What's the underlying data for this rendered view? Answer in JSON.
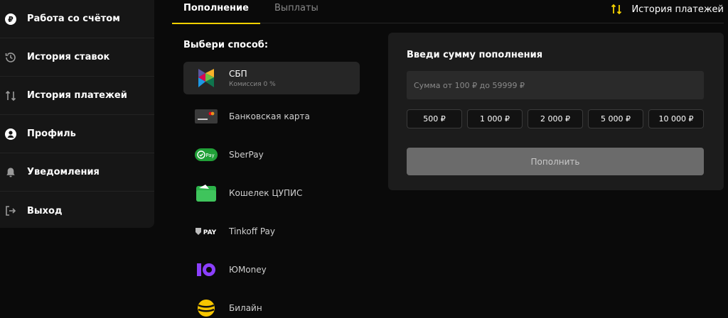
{
  "sidebar": {
    "items": [
      {
        "label": "Работа со счётом",
        "icon": "account-coin-icon"
      },
      {
        "label": "История ставок",
        "icon": "history-clock-icon"
      },
      {
        "label": "История платежей",
        "icon": "transfer-arrows-icon"
      },
      {
        "label": "Профиль",
        "icon": "user-icon"
      },
      {
        "label": "Уведомления",
        "icon": "bell-icon"
      },
      {
        "label": "Выход",
        "icon": "logout-icon"
      }
    ]
  },
  "tabs": {
    "deposit": "Пополнение",
    "withdraw": "Выплаты"
  },
  "header": {
    "payment_history": "История платежей"
  },
  "methods": {
    "title": "Выбери способ:",
    "items": [
      {
        "name": "СБП",
        "commission": "Комиссия 0 %",
        "icon": "sbp-logo-icon",
        "selected": true
      },
      {
        "name": "Банковская карта",
        "icon": "bank-card-icon"
      },
      {
        "name": "SberPay",
        "icon": "sberpay-logo-icon"
      },
      {
        "name": "Кошелек ЦУПИС",
        "icon": "cupis-wallet-icon"
      },
      {
        "name": "Tinkoff Pay",
        "icon": "tinkoff-pay-logo-icon"
      },
      {
        "name": "ЮMoney",
        "icon": "yoomoney-logo-icon"
      },
      {
        "name": "Билайн",
        "icon": "beeline-logo-icon"
      }
    ]
  },
  "deposit": {
    "title": "Введи сумму пополнения",
    "placeholder": "Сумма от 100 ₽ до 59999 ₽",
    "presets": [
      "500 ₽",
      "1 000 ₽",
      "2 000 ₽",
      "5 000 ₽",
      "10 000 ₽"
    ],
    "submit": "Пополнить"
  },
  "colors": {
    "accent": "#f4d100",
    "background": "#0a0a0a",
    "panel": "#1c1c1c"
  }
}
